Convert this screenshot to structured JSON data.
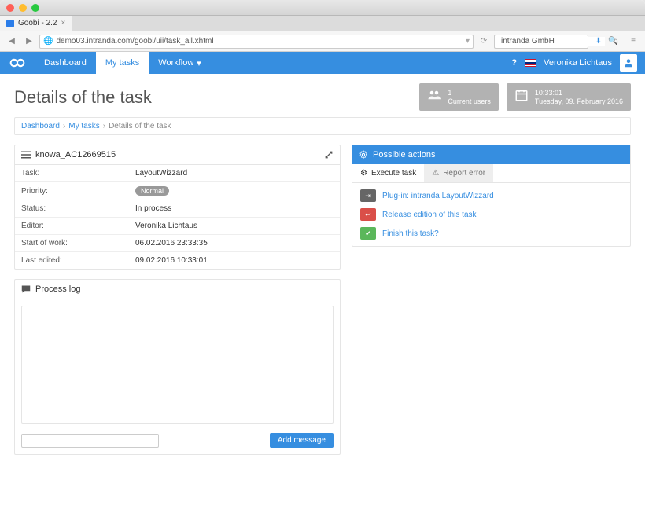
{
  "browser": {
    "tab_title": "Goobi - 2.2",
    "url": "demo03.intranda.com/goobi/uii/task_all.xhtml",
    "search_value": "intranda GmbH"
  },
  "nav": {
    "items": [
      {
        "label": "Dashboard"
      },
      {
        "label": "My tasks"
      },
      {
        "label": "Workflow"
      }
    ],
    "username": "Veronika Lichtaus"
  },
  "page": {
    "title": "Details of the task",
    "stats": {
      "users_count": "1",
      "users_label": "Current users",
      "time": "10:33:01",
      "date": "Tuesday, 09. February 2016"
    },
    "breadcrumb": [
      {
        "label": "Dashboard"
      },
      {
        "label": "My tasks"
      },
      {
        "label": "Details of the task"
      }
    ]
  },
  "task": {
    "name": "knowa_AC12669515",
    "rows": [
      {
        "label": "Task:",
        "value": "LayoutWizzard"
      },
      {
        "label": "Priority:",
        "value": "Normal",
        "badge": true
      },
      {
        "label": "Status:",
        "value": "In process"
      },
      {
        "label": "Editor:",
        "value": "Veronika Lichtaus"
      },
      {
        "label": "Start of work:",
        "value": "06.02.2016 23:33:35"
      },
      {
        "label": "Last edited:",
        "value": "09.02.2016 10:33:01"
      }
    ]
  },
  "processlog": {
    "title": "Process log",
    "add_button": "Add message"
  },
  "actions": {
    "title": "Possible actions",
    "tabs": [
      {
        "label": "Execute task"
      },
      {
        "label": "Report error"
      }
    ],
    "items": [
      {
        "label": "Plug-in: intranda LayoutWizzard",
        "icon": "grey"
      },
      {
        "label": "Release edition of this task",
        "icon": "red"
      },
      {
        "label": "Finish this task?",
        "icon": "green"
      }
    ]
  }
}
